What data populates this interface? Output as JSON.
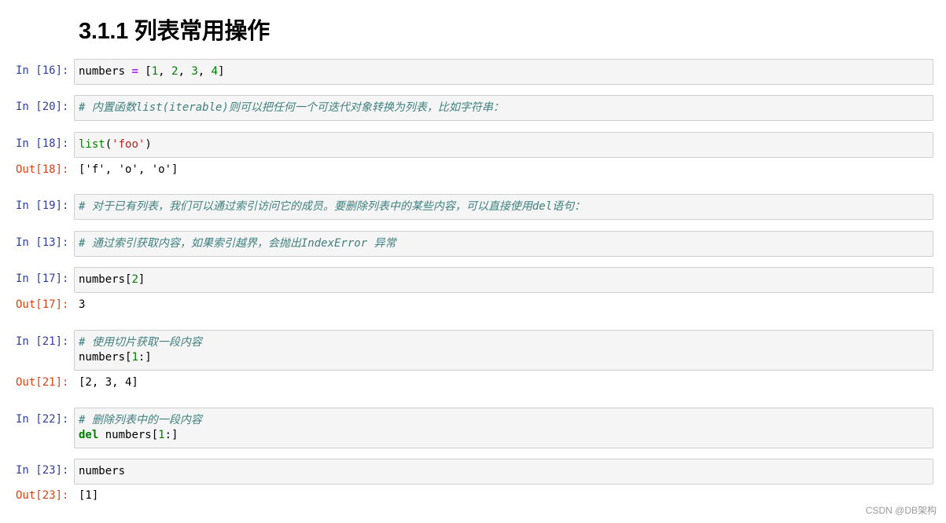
{
  "heading": "3.1.1 列表常用操作",
  "cells": [
    {
      "in": "In [16]:",
      "lines": [
        [
          [
            "numbers ",
            ""
          ],
          [
            "=",
            "op"
          ],
          [
            " [",
            ""
          ],
          [
            "1",
            "num"
          ],
          [
            ", ",
            ""
          ],
          [
            "2",
            "num"
          ],
          [
            ", ",
            ""
          ],
          [
            "3",
            "num"
          ],
          [
            ", ",
            ""
          ],
          [
            "4",
            "num"
          ],
          [
            "]",
            ""
          ]
        ]
      ]
    },
    {
      "in": "In [20]:",
      "lines": [
        [
          [
            "# 内置函数list(iterable)则可以把任何一个可迭代对象转换为列表，比如字符串：",
            "cm"
          ]
        ]
      ]
    },
    {
      "in": "In [18]:",
      "lines": [
        [
          [
            "list",
            "bi"
          ],
          [
            "(",
            ""
          ],
          [
            "'foo'",
            "str"
          ],
          [
            ")",
            ""
          ]
        ]
      ],
      "out": "Out[18]:",
      "out_text": "['f', 'o', 'o']"
    },
    {
      "in": "In [19]:",
      "lines": [
        [
          [
            "# 对于已有列表，我们可以通过索引访问它的成员。要删除列表中的某些内容，可以直接使用del语句：",
            "cm"
          ]
        ]
      ]
    },
    {
      "in": "In [13]:",
      "lines": [
        [
          [
            "# 通过索引获取内容，如果索引越界，会抛出IndexError 异常",
            "cm"
          ]
        ]
      ]
    },
    {
      "in": "In [17]:",
      "lines": [
        [
          [
            "numbers[",
            ""
          ],
          [
            "2",
            "num"
          ],
          [
            "]",
            ""
          ]
        ]
      ],
      "out": "Out[17]:",
      "out_text": "3"
    },
    {
      "in": "In [21]:",
      "lines": [
        [
          [
            "# 使用切片获取一段内容",
            "cm"
          ]
        ],
        [
          [
            "numbers[",
            ""
          ],
          [
            "1",
            "num"
          ],
          [
            ":]",
            ""
          ]
        ]
      ],
      "out": "Out[21]:",
      "out_text": "[2, 3, 4]"
    },
    {
      "in": "In [22]:",
      "lines": [
        [
          [
            "# 删除列表中的一段内容",
            "cm"
          ]
        ],
        [
          [
            "del",
            "kw"
          ],
          [
            " numbers[",
            ""
          ],
          [
            "1",
            "num"
          ],
          [
            ":]",
            ""
          ]
        ]
      ]
    },
    {
      "in": "In [23]:",
      "lines": [
        [
          [
            "numbers",
            ""
          ]
        ]
      ],
      "out": "Out[23]:",
      "out_text": "[1]"
    }
  ],
  "watermark": "CSDN @DB架构"
}
